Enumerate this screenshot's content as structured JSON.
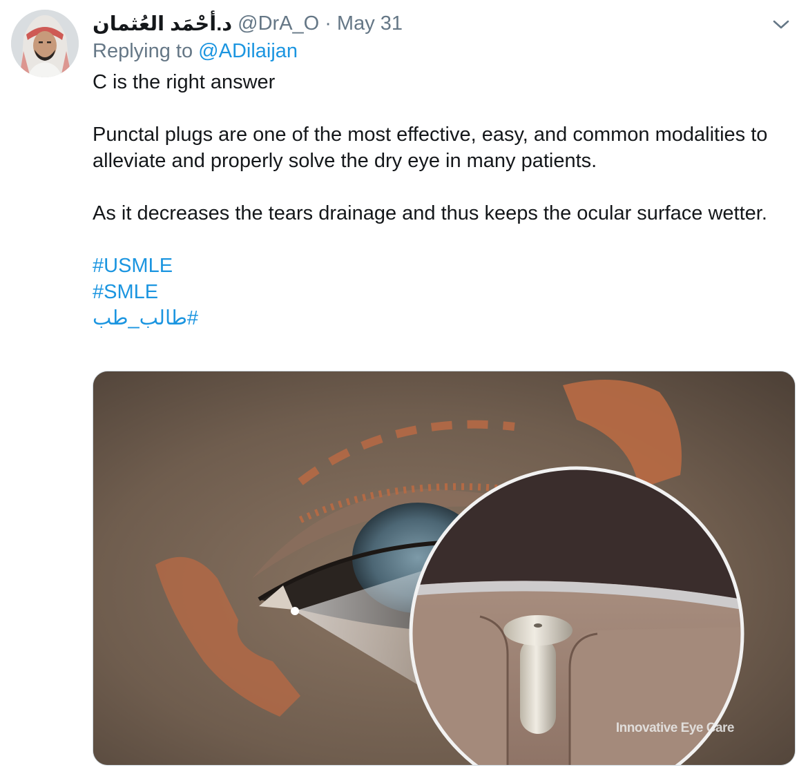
{
  "author": {
    "display_name": "د.أحْمَد العُثمان",
    "handle": "@DrA_O",
    "separator": "·",
    "date": "May 31",
    "avatar_icon": "profile-avatar"
  },
  "reply": {
    "prefix": "Replying to",
    "mention": "@ADilaijan"
  },
  "text": {
    "line1": "C is the right answer",
    "para2": "Punctal plugs are one of the most effective, easy, and common modalities to alleviate and properly solve the dry eye in many patients.",
    "para3": "As it decreases the tears drainage and thus keeps the ocular surface wetter."
  },
  "hashtags": [
    "#USMLE",
    "#SMLE",
    "#طالب_طب"
  ],
  "media": {
    "watermark": "Innovative Eye Care",
    "description_icon": "eye-punctal-plug-illustration"
  },
  "colors": {
    "link": "#1b95e0",
    "muted": "#657786",
    "text": "#14171a"
  },
  "menu_icon": "chevron-down-icon"
}
